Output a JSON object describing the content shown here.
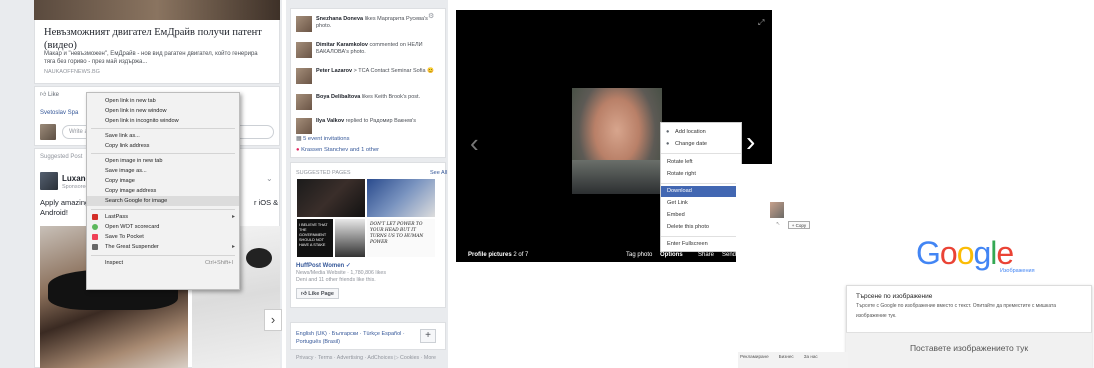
{
  "feed": {
    "news_title": "Невъзможният двигател ЕмДрайв получи патент (видео)",
    "news_desc": "Макар и \"невъзможен\", ЕмДрайв - нов вид рагатен двигател, който генерира тяга без гориво - през май издържа...",
    "news_source": "NAUKAOFFNEWS.BG",
    "like_label": "Like",
    "commenter": "Svetoslav Spa",
    "write_comment_placeholder": "Write a c",
    "suggested_label": "Suggested Post",
    "sponsor_name": "Luxand",
    "sponsor_sub": "Sponsored",
    "ad_text_left": "Apply amazing",
    "ad_text_left2": "Android!",
    "ad_text_right": "r iOS &",
    "next_arrow": "›"
  },
  "context_menu": {
    "items": [
      {
        "label": "Open link in new tab"
      },
      {
        "label": "Open link in new window"
      },
      {
        "label": "Open link in incognito window"
      },
      {
        "label": "Save link as..."
      },
      {
        "label": "Copy link address"
      },
      {
        "label": "Open image in new tab"
      },
      {
        "label": "Save image as..."
      },
      {
        "label": "Copy image"
      },
      {
        "label": "Copy image address"
      },
      {
        "label": "Search Google for image"
      },
      {
        "label": "LastPass"
      },
      {
        "label": "Open WOT scorecard"
      },
      {
        "label": "Save To Pocket"
      },
      {
        "label": "The Great Suspender"
      },
      {
        "label": "Inspect",
        "shortcut": "Ctrl+Shift+I"
      }
    ],
    "icon_colors": {
      "lastpass": "#d32d27",
      "wot": "#5cb85c",
      "pocket": "#ef4056",
      "suspender": "#666666"
    }
  },
  "sidebar": {
    "ticker": [
      {
        "name": "Snezhana Doneva",
        "text": "likes Маргарита Русева's photo."
      },
      {
        "name": "Dimitar Karamkolov",
        "text": "commented on НЕЛИ БАКАЛОВА's photo."
      },
      {
        "name": "Peter Lazarov",
        "text": "> TCA Contact Seminar Sofia 😊"
      },
      {
        "name": "Boya Delibaltova",
        "text": "likes Keith Brook's post."
      },
      {
        "name": "Ilya Valkov",
        "text": "replied to Радомир Вакнев's"
      }
    ],
    "event_invitations": "5 event invitations",
    "birthday": "Krassen Stanchev and 1 other",
    "suggested_pages": "SUGGESTED PAGES",
    "see_all": "See All",
    "handwriting": "DON'T LET POWER TO YOUR HEAD BUT IT TURNS US TO HUMAN POWER",
    "believe": "I BELIEVE THAT THE GOVERNMENT SHOULD NOT HAVE A STAKE",
    "page_name": "HuffPost Women",
    "page_meta": "News/Media Website · 1,780,806 likes",
    "page_friends": "Deni and 11 other friends like this.",
    "like_page": "Like Page",
    "languages": "English (UK) · Български · Türkçe Español · Português (Brasil)",
    "plus": "+",
    "footer": "Privacy · Terms · Advertising · AdChoices ▷ Cookies · More"
  },
  "viewer": {
    "options_menu": [
      {
        "label": "Add location",
        "icon": true
      },
      {
        "label": "Change date",
        "icon": true
      },
      {
        "label": "Rotate left"
      },
      {
        "label": "Rotate right"
      },
      {
        "label": "Download",
        "highlight": true
      },
      {
        "label": "Get Link"
      },
      {
        "label": "Embed"
      },
      {
        "label": "Delete this photo"
      },
      {
        "label": "Enter Fullscreen"
      }
    ],
    "album": "Profile pictures",
    "counter": "2 of 7",
    "tag_photo": "Tag photo",
    "options": "Options",
    "share": "Share",
    "send": "Send"
  },
  "google": {
    "copy_tip": "+ Copy",
    "logo_letters": [
      {
        "ch": "G",
        "color": "#4285f4"
      },
      {
        "ch": "o",
        "color": "#ea4335"
      },
      {
        "ch": "o",
        "color": "#fbbc05"
      },
      {
        "ch": "g",
        "color": "#4285f4"
      },
      {
        "ch": "l",
        "color": "#34a853"
      },
      {
        "ch": "e",
        "color": "#ea4335"
      }
    ],
    "logo_sub": "Изображения",
    "search_title": "Търсене по изображение",
    "search_desc": "Търсете с Google по изображение вместо с текст. Опитайте да преместите с мишката изображение тук.",
    "paste_here": "Поставете изображението тук",
    "footer_links": [
      "Рекламиране",
      "Бизнес",
      "За нас"
    ]
  }
}
